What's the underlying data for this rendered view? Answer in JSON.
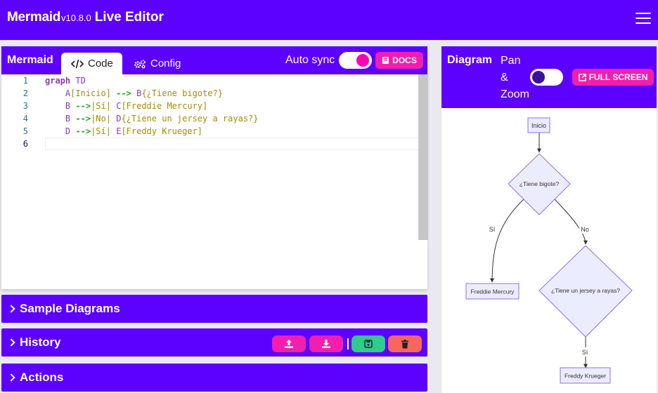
{
  "app": {
    "name": "Mermaid",
    "version": "v10.8.0",
    "subtitle": "Live Editor",
    "menu_icon": "hamburger-menu-icon"
  },
  "editor_panel": {
    "title": "Mermaid",
    "tabs": [
      {
        "label": "Code",
        "icon": "code-icon",
        "active": true
      },
      {
        "label": "Config",
        "icon": "gears-icon",
        "active": false
      }
    ],
    "auto_sync_label": "Auto sync",
    "auto_sync_on": true,
    "docs_label": "DOCS",
    "line_numbers": [
      "1",
      "2",
      "3",
      "4",
      "5",
      "6"
    ],
    "code_lines": [
      "graph TD",
      "    A[Inicio] --> B{¿Tiene bigote?}",
      "    B -->|Sí| C[Freddie Mercury]",
      "    B -->|No| D{¿Tiene un jersey a rayas?}",
      "    D -->|Sí| E[Freddy Krueger]",
      ""
    ],
    "active_line": 6
  },
  "sections": {
    "samples_label": "Sample Diagrams",
    "history_label": "History",
    "actions_label": "Actions"
  },
  "history_buttons": [
    {
      "icon": "upload-icon",
      "color": "#f21eb0"
    },
    {
      "icon": "download-icon",
      "color": "#f21eb0"
    },
    {
      "icon": "save-icon",
      "color": "#2fcc8b"
    },
    {
      "icon": "trash-icon",
      "color": "#f7665e"
    }
  ],
  "diagram_panel": {
    "title": "Diagram",
    "pan_zoom_words": [
      "Pan",
      "&",
      "Zoom"
    ],
    "pan_zoom_on": false,
    "fullscreen_label": "FULL SCREEN"
  },
  "flowchart": {
    "nodes": {
      "A": "Inicio",
      "B": "¿Tiene bigote?",
      "C": "Freddie Mercury",
      "D": "¿Tiene un jersey a rayas?",
      "E": "Freddy Krueger"
    },
    "edge_labels": {
      "B_C": "Sí",
      "B_D": "No",
      "D_E": "Sí"
    }
  },
  "colors": {
    "primary": "#5c00ff",
    "accent": "#f21eb0",
    "success": "#2fcc8b",
    "danger": "#f7665e",
    "node_fill": "#ececff",
    "node_stroke": "#9370db"
  }
}
